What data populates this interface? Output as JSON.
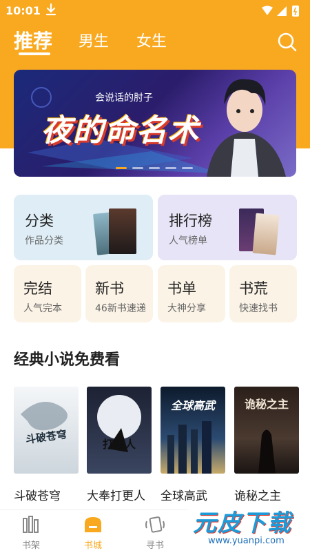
{
  "status_bar": {
    "time": "10:01"
  },
  "header": {
    "tabs": [
      {
        "label": "推荐",
        "active": true
      },
      {
        "label": "男生",
        "active": false
      },
      {
        "label": "女生",
        "active": false
      }
    ]
  },
  "banner": {
    "subtitle": "会说话的肘子",
    "title": "夜的命名术",
    "slide_count": 5,
    "active_slide": 0
  },
  "categories": {
    "large": [
      {
        "title": "分类",
        "subtitle": "作品分类"
      },
      {
        "title": "排行榜",
        "subtitle": "人气榜单"
      }
    ],
    "small": [
      {
        "title": "完结",
        "subtitle": "人气完本"
      },
      {
        "title": "新书",
        "subtitle": "46新书速递"
      },
      {
        "title": "书单",
        "subtitle": "大神分享"
      },
      {
        "title": "书荒",
        "subtitle": "快速找书"
      }
    ]
  },
  "section": {
    "title": "经典小说免费看",
    "novels": [
      {
        "name": "斗破苍穹",
        "cover_text": "斗破苍穹"
      },
      {
        "name": "大奉打更人",
        "cover_text": "打更人"
      },
      {
        "name": "全球高武",
        "cover_text": "全球高武"
      },
      {
        "name": "诡秘之主",
        "cover_text": "诡秘之主"
      }
    ]
  },
  "bottom_nav": [
    {
      "label": "书架",
      "icon": "bookshelf-icon",
      "active": false
    },
    {
      "label": "书城",
      "icon": "bookstore-icon",
      "active": true
    },
    {
      "label": "寻书",
      "icon": "find-book-icon",
      "active": false
    }
  ],
  "watermark": {
    "text": "元皮下载",
    "url": "www.yuanpi.com"
  },
  "colors": {
    "accent": "#f9a91f",
    "blue_card": "#dfeef6",
    "purple_card": "#e6e4f6",
    "cream_card": "#fbf3e6"
  }
}
